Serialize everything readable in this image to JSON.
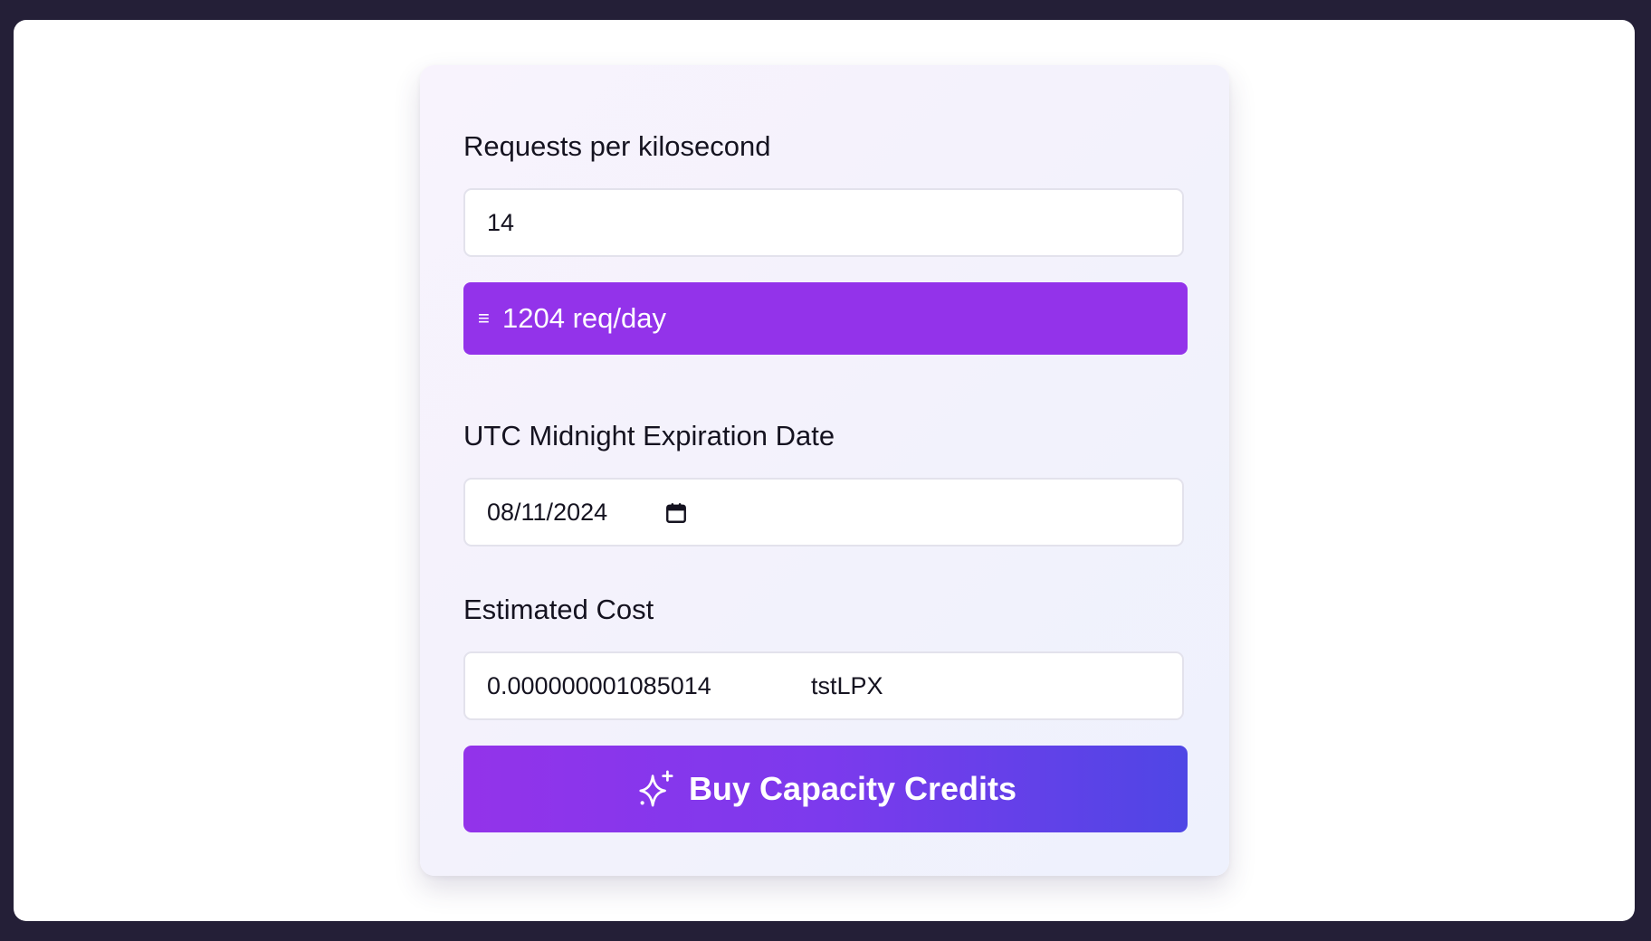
{
  "form": {
    "requests_label": "Requests per kilosecond",
    "requests_value": "14",
    "conversion_symbol": "≡",
    "conversion_text": "1204 req/day",
    "expiration_label": "UTC Midnight Expiration Date",
    "expiration_value": "08/11/2024",
    "cost_label": "Estimated Cost",
    "cost_value": "0.000000001085014",
    "cost_currency": "tstLPX",
    "buy_button_label": "Buy Capacity Credits"
  },
  "icons": {
    "date_picker": "calendar-icon",
    "buy_button": "sparkles-icon"
  },
  "colors": {
    "accent": "#9333ea",
    "button_gradient_start": "#9333ea",
    "button_gradient_end": "#4f46e5",
    "backdrop": "#241f37"
  }
}
